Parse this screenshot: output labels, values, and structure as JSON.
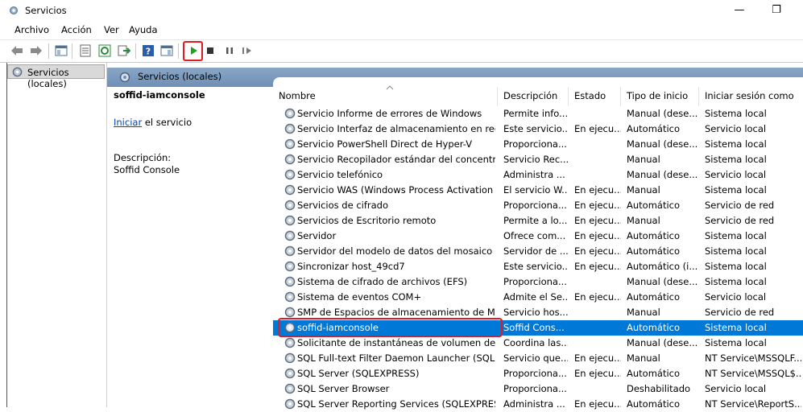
{
  "window": {
    "title": "Servicios",
    "minimize_glyph": "—",
    "restore_glyph": "❐"
  },
  "menu": [
    "Archivo",
    "Acción",
    "Ver",
    "Ayuda"
  ],
  "toolbar": {
    "icons": [
      "back-icon",
      "forward-icon",
      "show-tree-icon",
      "properties-icon",
      "refresh-icon",
      "export-icon",
      "help-icon",
      "console-icon",
      "start-service-icon",
      "stop-service-icon",
      "pause-service-icon",
      "resume-service-icon"
    ]
  },
  "tree": {
    "root_label": "Servicios (locales)"
  },
  "panel": {
    "header_label": "Servicios (locales)",
    "selected_name": "soffid-iamconsole",
    "start_link": "Iniciar",
    "start_rest": " el servicio",
    "desc_label": "Descripción:",
    "desc_value": "Soffid Console"
  },
  "table": {
    "columns": [
      "Nombre",
      "Descripción",
      "Estado",
      "Tipo de inicio",
      "Iniciar sesión como"
    ],
    "rows": [
      [
        "Servicio Informe de errores de Windows",
        "Permite info...",
        "",
        "Manual (dese...",
        "Sistema local"
      ],
      [
        "Servicio Interfaz de almacenamiento en red",
        "Este servicio...",
        "En ejecu...",
        "Automático",
        "Servicio local"
      ],
      [
        "Servicio PowerShell Direct de Hyper-V",
        "Proporciona...",
        "",
        "Manual (dese...",
        "Sistema local"
      ],
      [
        "Servicio Recopilador estándar del concentrad...",
        "Servicio Rec...",
        "",
        "Manual",
        "Sistema local"
      ],
      [
        "Servicio telefónico",
        "Administra ...",
        "",
        "Manual (dese...",
        "Servicio local"
      ],
      [
        "Servicio WAS (Windows Process Activation S...",
        "El servicio W...",
        "En ejecu...",
        "Manual",
        "Sistema local"
      ],
      [
        "Servicios de cifrado",
        "Proporciona...",
        "En ejecu...",
        "Automático",
        "Servicio de red"
      ],
      [
        "Servicios de Escritorio remoto",
        "Permite a lo...",
        "En ejecu...",
        "Manual",
        "Servicio de red"
      ],
      [
        "Servidor",
        "Ofrece com...",
        "En ejecu...",
        "Automático",
        "Sistema local"
      ],
      [
        "Servidor del modelo de datos del mosaico",
        "Servidor de ...",
        "En ejecu...",
        "Automático",
        "Sistema local"
      ],
      [
        "Sincronizar host_49cd7",
        "Este servicio...",
        "En ejecu...",
        "Automático (i...",
        "Sistema local"
      ],
      [
        "Sistema de cifrado de archivos (EFS)",
        "Proporciona...",
        "",
        "Manual (dese...",
        "Sistema local"
      ],
      [
        "Sistema de eventos COM+",
        "Admite el Se...",
        "En ejecu...",
        "Automático",
        "Servicio local"
      ],
      [
        "SMP de Espacios de almacenamiento de Micr...",
        "Servicio hos...",
        "",
        "Manual",
        "Servicio de red"
      ],
      [
        "soffid-iamconsole",
        "Soffid Cons...",
        "",
        "Automático",
        "Sistema local"
      ],
      [
        "Solicitante de instantáneas de volumen de H...",
        "Coordina las...",
        "",
        "Manual (dese...",
        "Sistema local"
      ],
      [
        "SQL Full-text Filter Daemon Launcher (SQLEX...",
        "Servicio que...",
        "En ejecu...",
        "Manual",
        "NT Service\\MSSQLF..."
      ],
      [
        "SQL Server (SQLEXPRESS)",
        "Proporciona...",
        "En ejecu...",
        "Automático",
        "NT Service\\MSSQL$..."
      ],
      [
        "SQL Server Browser",
        "Proporciona...",
        "",
        "Deshabilitado",
        "Servicio local"
      ],
      [
        "SQL Server Reporting Services (SQLEXPRESS)",
        "Administra ...",
        "En ejecu...",
        "Automático",
        "NT Service\\ReportS..."
      ]
    ],
    "selected_index": 14
  },
  "colors": {
    "selection": "#0078d7",
    "highlight_box": "#e01b22",
    "header_gradient": "#7d9bc0"
  }
}
